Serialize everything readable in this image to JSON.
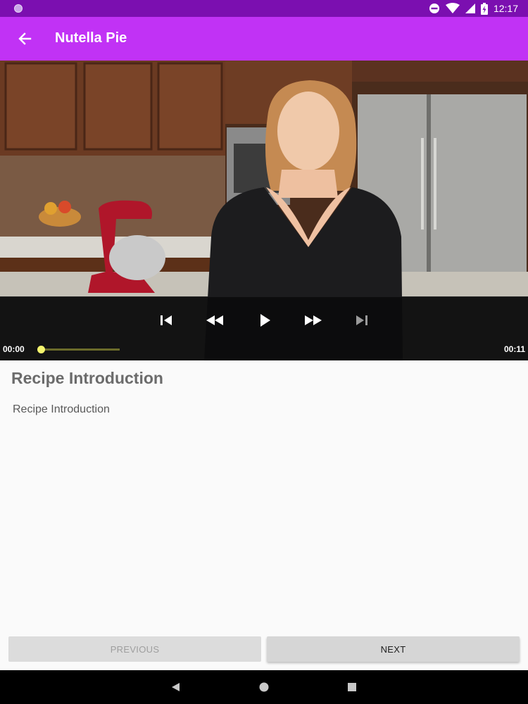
{
  "status_bar": {
    "time": "12:17",
    "icons": [
      "notification-dot-icon",
      "do-not-disturb-icon",
      "wifi-icon",
      "cell-signal-icon",
      "battery-charging-icon"
    ]
  },
  "app_bar": {
    "title": "Nutella Pie",
    "back_icon": "arrow-back-icon",
    "background": "#c132f5",
    "status_bar_color": "#7b0fb0"
  },
  "video_player": {
    "current_time": "00:00",
    "duration": "00:11",
    "progress": 0.0,
    "controls": [
      "skip-previous-icon",
      "rewind-icon",
      "play-icon",
      "fast-forward-icon",
      "skip-next-icon"
    ],
    "skip_next_enabled": false,
    "progress_color": "#f5f56e"
  },
  "step": {
    "title": "Recipe Introduction",
    "description": "Recipe Introduction"
  },
  "navigation_buttons": {
    "previous_label": "PREVIOUS",
    "previous_enabled": false,
    "next_label": "NEXT",
    "next_enabled": true
  },
  "system_nav": {
    "icons": [
      "back-triangle-icon",
      "home-circle-icon",
      "recents-square-icon"
    ]
  }
}
